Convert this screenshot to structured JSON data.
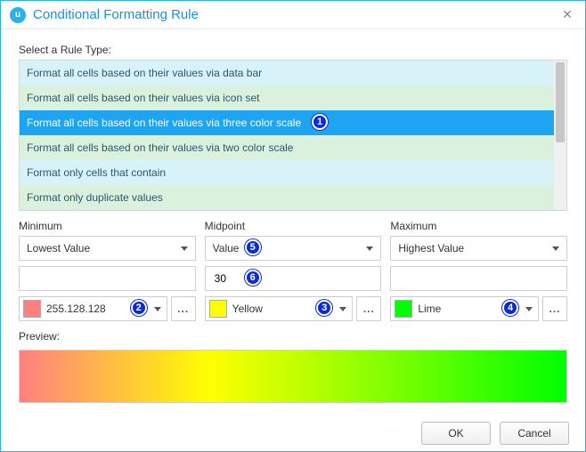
{
  "window": {
    "title": "Conditional Formatting Rule"
  },
  "labels": {
    "select_rule_type": "Select a Rule Type:",
    "minimum": "Minimum",
    "midpoint": "Midpoint",
    "maximum": "Maximum",
    "preview": "Preview:"
  },
  "rule_types": [
    "Format all cells based on their values via data bar",
    "Format all cells based on their values via icon set",
    "Format all cells based on their values via three color scale",
    "Format all cells based on their values via two color scale",
    "Format only cells that contain",
    "Format only duplicate values"
  ],
  "selected_rule_index": 2,
  "minimum": {
    "type": "Lowest Value",
    "value": "",
    "color_label": "255.128.128",
    "color_hex": "#ff8080"
  },
  "midpoint": {
    "type": "Value",
    "value": "30",
    "color_label": "Yellow",
    "color_hex": "#ffff00"
  },
  "maximum": {
    "type": "Highest Value",
    "value": "",
    "color_label": "Lime",
    "color_hex": "#00ff00"
  },
  "footer": {
    "ok": "OK",
    "cancel": "Cancel"
  },
  "callouts": {
    "1": "1",
    "2": "2",
    "3": "3",
    "4": "4",
    "5": "5",
    "6": "6"
  },
  "glyphs": {
    "close": "✕",
    "more": "..."
  }
}
